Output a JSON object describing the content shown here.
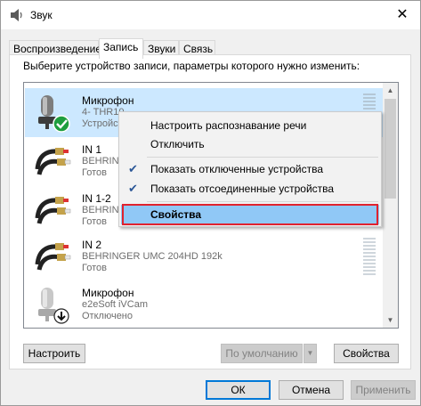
{
  "window": {
    "title": "Звук",
    "close_glyph": "✕",
    "background_peek_text": "…"
  },
  "tabs": [
    {
      "label": "Воспроизведение",
      "active": false
    },
    {
      "label": "Запись",
      "active": true
    },
    {
      "label": "Звуки",
      "active": false
    },
    {
      "label": "Связь",
      "active": false
    }
  ],
  "instruction": "Выберите устройство записи, параметры которого нужно изменить:",
  "devices": [
    {
      "name": "Микрофон",
      "description": "4- THR10",
      "status": "Устройст",
      "icon": "microphone-icon",
      "badge": "default-check-badge",
      "selected": true
    },
    {
      "name": "IN 1",
      "description": "BEHRING",
      "status": "Готов",
      "icon": "rca-cable-icon",
      "selected": false
    },
    {
      "name": "IN 1-2",
      "description": "BEHRING",
      "status": "Готов",
      "icon": "rca-cable-icon",
      "selected": false
    },
    {
      "name": "IN 2",
      "description": "BEHRINGER UMC 204HD 192k",
      "status": "Готов",
      "icon": "rca-cable-icon",
      "selected": false
    },
    {
      "name": "Микрофон",
      "description": "e2eSoft iVCam",
      "status": "Отключено",
      "icon": "microphone-icon",
      "badge": "disabled-arrow-badge",
      "selected": false
    }
  ],
  "context_menu": {
    "items": [
      {
        "label": "Настроить распознавание речи",
        "checked": false
      },
      {
        "label": "Отключить",
        "checked": false
      },
      {
        "label": "Показать отключенные устройства",
        "checked": true
      },
      {
        "label": "Показать отсоединенные устройства",
        "checked": true
      },
      {
        "label": "Свойства",
        "checked": false,
        "highlighted": true
      }
    ],
    "check_glyph": "✔"
  },
  "buttons": {
    "configure": "Настроить",
    "set_default": "По умолчанию",
    "properties": "Свойства",
    "ok": "ОК",
    "cancel": "Отмена",
    "apply": "Применить"
  },
  "colors": {
    "selection": "#cce8ff",
    "menu_highlight": "#90c8f6",
    "annotation_border": "#e0222e",
    "check_badge": "#1e9e3e"
  }
}
